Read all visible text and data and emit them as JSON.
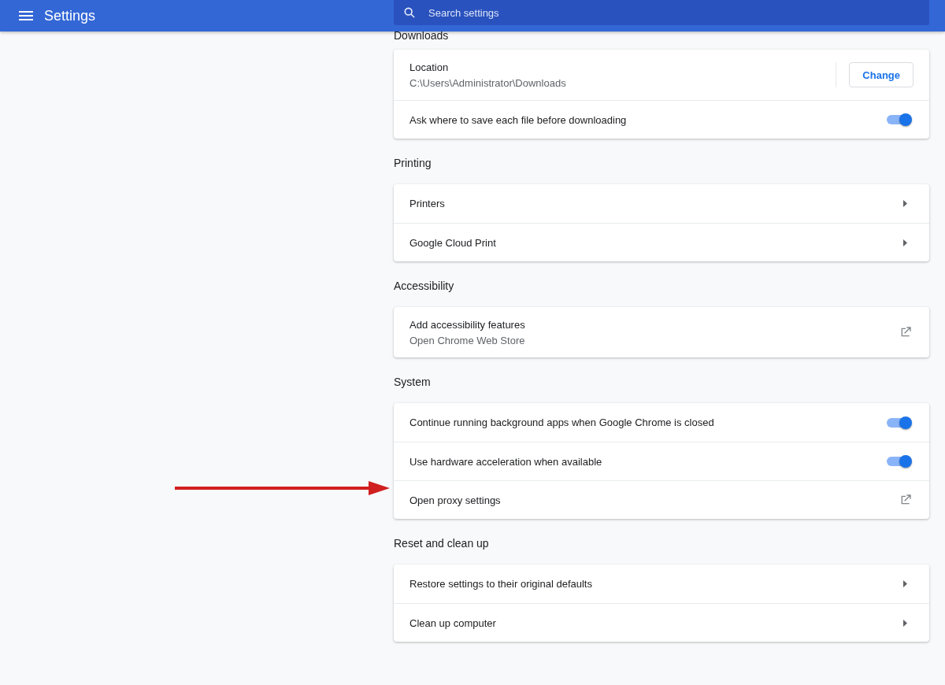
{
  "header": {
    "title": "Settings",
    "search": {
      "placeholder": "Search settings"
    }
  },
  "sections": [
    {
      "title": "Downloads",
      "rows": [
        {
          "kind": "button",
          "label": "Location",
          "secondary": "C:\\Users\\Administrator\\Downloads",
          "button": "Change"
        },
        {
          "kind": "toggle",
          "label": "Ask where to save each file before downloading",
          "on": true
        }
      ]
    },
    {
      "title": "Printing",
      "rows": [
        {
          "kind": "arrow",
          "label": "Printers"
        },
        {
          "kind": "arrow",
          "label": "Google Cloud Print"
        }
      ]
    },
    {
      "title": "Accessibility",
      "rows": [
        {
          "kind": "external",
          "label": "Add accessibility features",
          "secondary": "Open Chrome Web Store"
        }
      ]
    },
    {
      "title": "System",
      "rows": [
        {
          "kind": "toggle",
          "label": "Continue running background apps when Google Chrome is closed",
          "on": true
        },
        {
          "kind": "toggle",
          "label": "Use hardware acceleration when available",
          "on": true
        },
        {
          "kind": "external",
          "label": "Open proxy settings"
        }
      ]
    },
    {
      "title": "Reset and clean up",
      "rows": [
        {
          "kind": "arrow",
          "label": "Restore settings to their original defaults"
        },
        {
          "kind": "arrow",
          "label": "Clean up computer"
        }
      ]
    }
  ]
}
